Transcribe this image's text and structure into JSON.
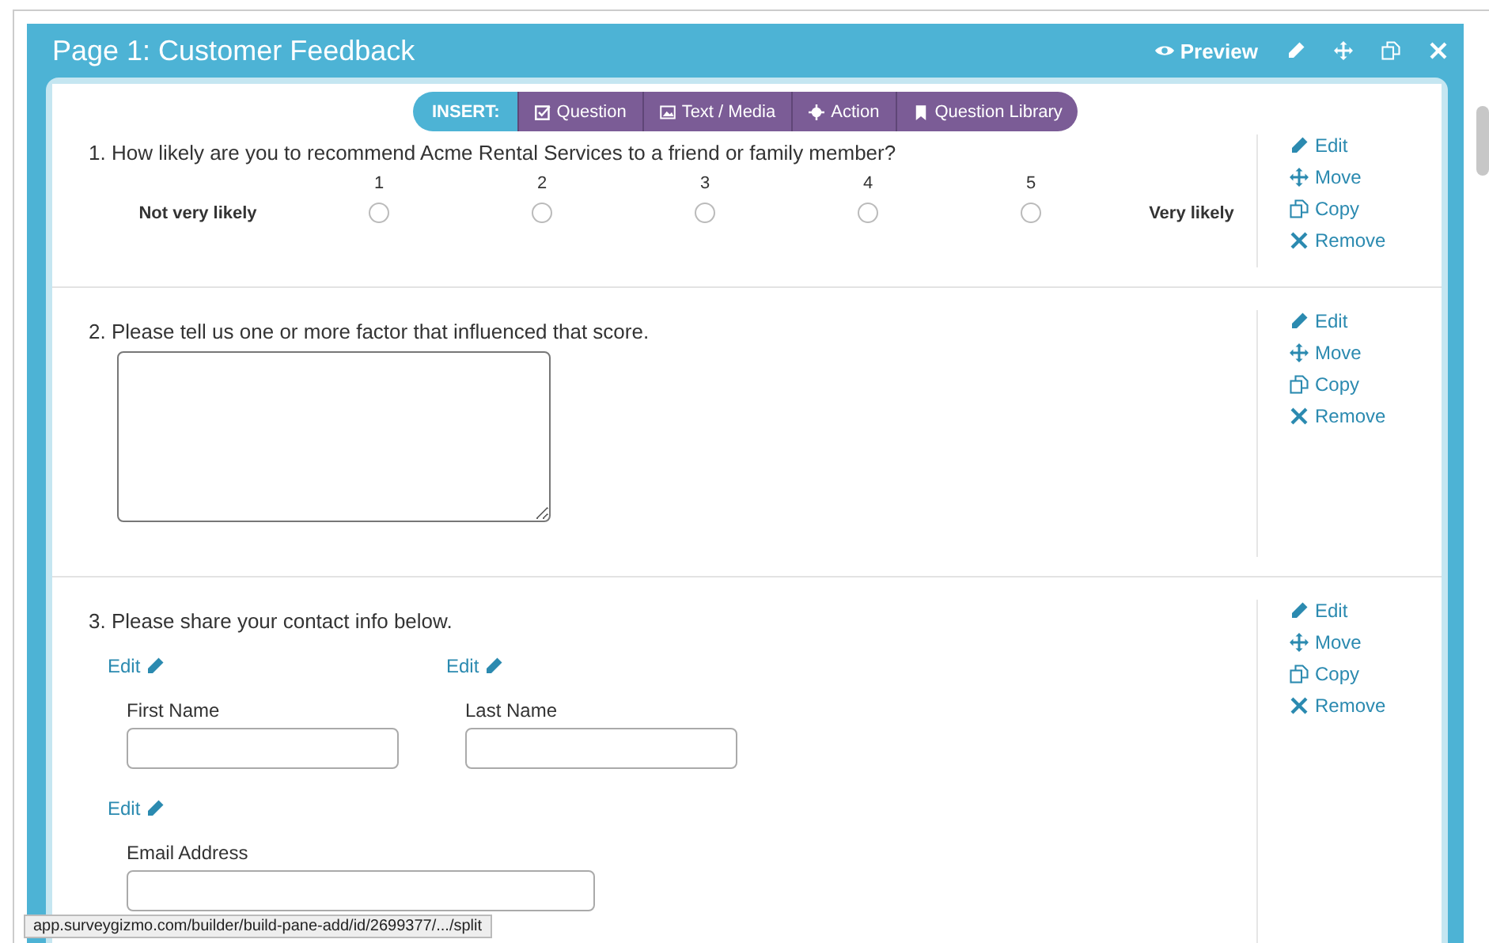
{
  "page": {
    "title": "Page 1: Customer Feedback",
    "preview": "Preview"
  },
  "insert_bar": {
    "label": "INSERT:",
    "items": [
      {
        "kind": "question",
        "label": "Question"
      },
      {
        "kind": "media",
        "label": "Text / Media"
      },
      {
        "kind": "action",
        "label": "Action"
      },
      {
        "kind": "library",
        "label": "Question Library"
      }
    ]
  },
  "questions": [
    {
      "kind": "scale",
      "title": "1. How likely are you to recommend Acme Rental Services to a friend or family member?",
      "low_label": "Not very likely",
      "high_label": "Very likely",
      "options": [
        {
          "label": "1",
          "selected": false
        },
        {
          "label": "2",
          "selected": false
        },
        {
          "label": "3",
          "selected": false
        },
        {
          "label": "4",
          "selected": false
        },
        {
          "label": "5",
          "selected": false
        }
      ],
      "actions": [
        "Edit",
        "Move",
        "Copy",
        "Remove"
      ]
    },
    {
      "kind": "textarea",
      "title": "2. Please tell us one or more factor that influenced that score.",
      "actions": [
        "Edit",
        "Move",
        "Copy",
        "Remove"
      ]
    },
    {
      "kind": "contact",
      "title": "3. Please share your contact info below.",
      "fields": [
        {
          "edit": "Edit",
          "label": "First Name"
        },
        {
          "edit": "Edit",
          "label": "Last Name"
        },
        {
          "edit": "Edit",
          "label": "Email Address"
        }
      ],
      "actions": [
        "Edit",
        "Move",
        "Copy",
        "Remove"
      ]
    }
  ],
  "status_bar": "app.surveygizmo.com/builder/build-pane-add/id/2699377/.../split"
}
